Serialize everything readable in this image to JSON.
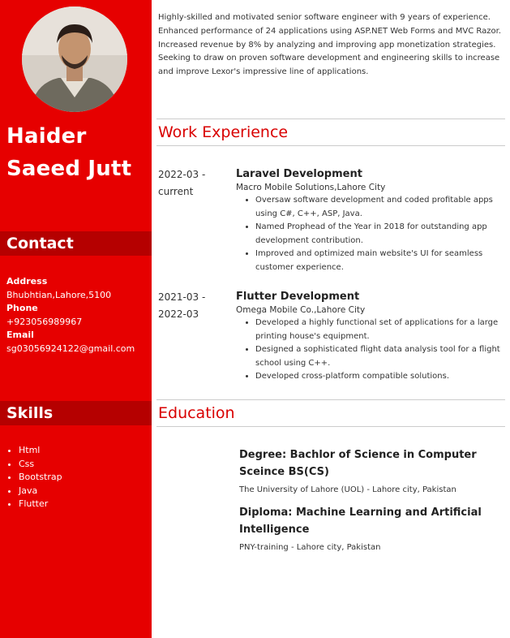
{
  "sidebar": {
    "name_line1": "Haider",
    "name_line2": "Saeed Jutt",
    "contact_heading": "Contact",
    "contact": {
      "address_label": "Address",
      "address": "Bhubhtian,Lahore,5100",
      "phone_label": "Phone",
      "phone": "+923056989967",
      "email_label": "Email",
      "email": "sg03056924122@gmail.com"
    },
    "skills_heading": "Skills",
    "skills": [
      "Html",
      "Css",
      "Bootstrap",
      "Java",
      "Flutter"
    ]
  },
  "summary": "Highly-skilled and motivated senior software engineer with 9 years of experience. Enhanced performance of 24 applications using ASP.NET Web Forms and MVC Razor. Increased revenue by 8% by analyzing and improving app monetization strategies. Seeking to draw on proven software development and engineering skills to increase and improve Lexor's impressive line of applications.",
  "work": {
    "heading": "Work Experience",
    "jobs": [
      {
        "date_start": "2022-03 -",
        "date_end": "current",
        "title": "Laravel Development",
        "company": "Macro Mobile Solutions,Lahore City",
        "bullets": [
          "Oversaw software development and coded profitable apps using C#, C++, ASP, Java.",
          "Named Prophead of the Year in 2018 for outstanding app development contribution.",
          "Improved and optimized main website's UI for seamless customer experience."
        ]
      },
      {
        "date_start": "2021-03 -",
        "date_end": "2022-03",
        "title": "Flutter Development",
        "company": "Omega Mobile Co.,Lahore City",
        "bullets": [
          "Developed a highly functional set of applications for a large printing house's equipment.",
          "Designed a sophisticated flight data analysis tool for a flight school using C++.",
          "Developed cross-platform compatible solutions."
        ]
      }
    ]
  },
  "education": {
    "heading": "Education",
    "items": [
      {
        "degree": "Degree: Bachlor of Science in Computer Sceince BS(CS)",
        "school": "The University of Lahore (UOL) - Lahore city, Pakistan"
      },
      {
        "degree": "Diploma: Machine Learning and Artificial Intelligence",
        "school": "PNY-training - Lahore city, Pakistan"
      }
    ]
  }
}
